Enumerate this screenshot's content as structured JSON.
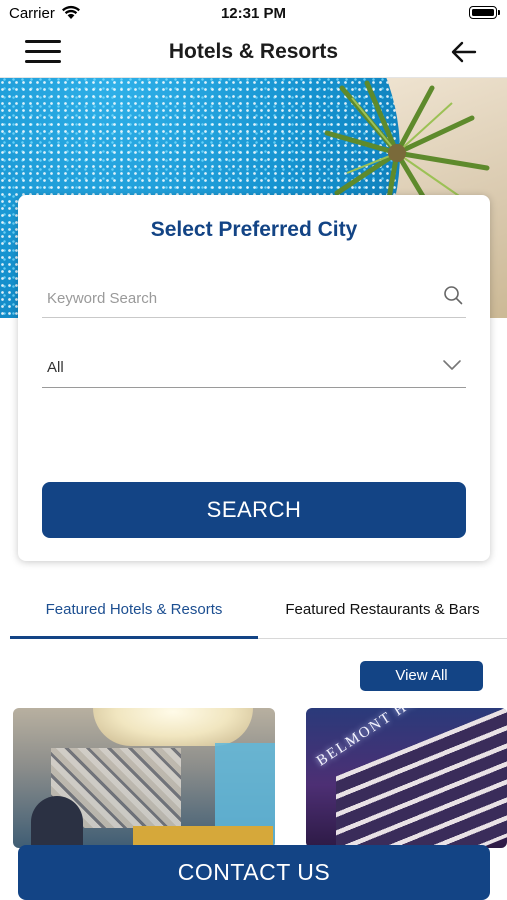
{
  "status_bar": {
    "carrier": "Carrier",
    "time": "12:31 PM"
  },
  "nav": {
    "title": "Hotels & Resorts",
    "menu_icon": "hamburger-menu-icon",
    "back_icon": "arrow-left-icon"
  },
  "search_card": {
    "title": "Select Preferred City",
    "keyword_placeholder": "Keyword Search",
    "keyword_value": "",
    "city_selected": "All",
    "search_label": "SEARCH"
  },
  "tabs": [
    {
      "label": "Featured Hotels & Resorts",
      "active": true
    },
    {
      "label": "Featured Restaurants & Bars",
      "active": false
    }
  ],
  "view_all_label": "View All",
  "featured_cards": [
    {
      "sign_text": ""
    },
    {
      "sign_text": "BELMONT HOTEL"
    }
  ],
  "contact_label": "CONTACT US",
  "colors": {
    "brand_blue": "#134485",
    "tab_active": "#1d4f91",
    "background": "#ffffff"
  }
}
